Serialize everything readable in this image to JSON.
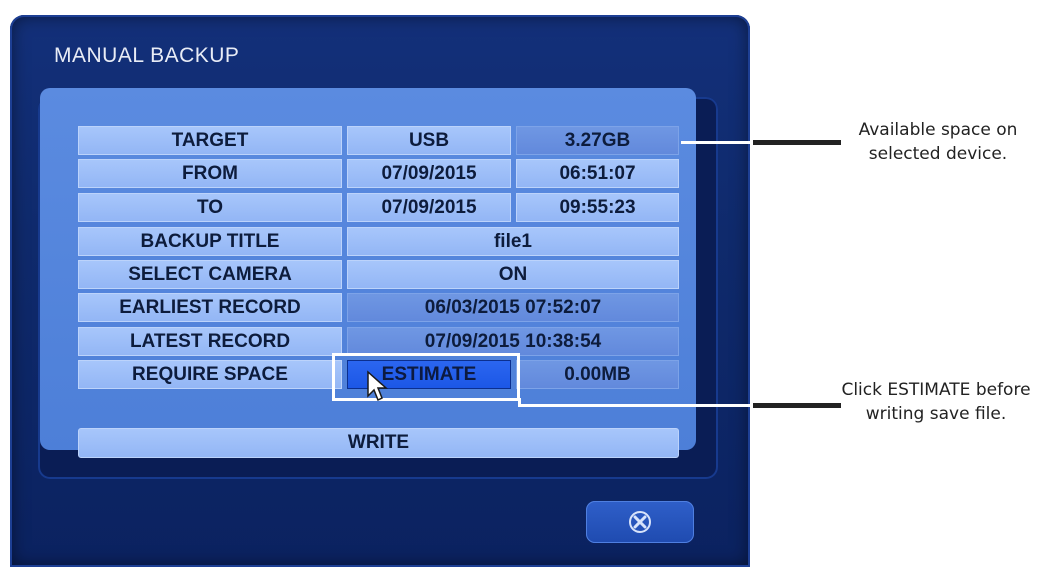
{
  "dialog": {
    "title": "MANUAL BACKUP"
  },
  "rows": {
    "target": {
      "label": "TARGET",
      "device": "USB",
      "space": "3.27GB"
    },
    "from": {
      "label": "FROM",
      "date": "07/09/2015",
      "time": "06:51:07"
    },
    "to": {
      "label": "TO",
      "date": "07/09/2015",
      "time": "09:55:23"
    },
    "backup_title": {
      "label": "BACKUP TITLE",
      "value": "file1"
    },
    "select_camera": {
      "label": "SELECT CAMERA",
      "value": "ON"
    },
    "earliest_record": {
      "label": "EARLIEST RECORD",
      "value": "06/03/2015 07:52:07"
    },
    "latest_record": {
      "label": "LATEST RECORD",
      "value": "07/09/2015 10:38:54"
    },
    "require_space": {
      "label": "REQUIRE SPACE",
      "button": "ESTIMATE",
      "value": "0.00MB"
    }
  },
  "write_button": "WRITE",
  "close_icon": "close-x-icon",
  "annotations": {
    "available_space_line1": "Available space on",
    "available_space_line2": "selected device.",
    "estimate_line1": "Click ESTIMATE before",
    "estimate_line2": "writing save file."
  },
  "colors": {
    "dialog_bg": "#13307a",
    "cell_light": "#a7c6fb",
    "cell_dark": "#6f97e3",
    "estimate_button": "#2b66f0"
  }
}
